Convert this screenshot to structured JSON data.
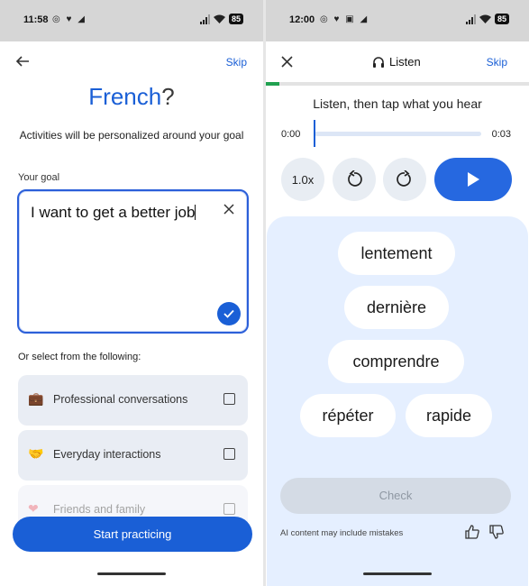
{
  "left": {
    "status": {
      "time": "11:58",
      "icons": "◎ ♥ ◢",
      "battery": "85"
    },
    "skip": "Skip",
    "title": {
      "lang": "French",
      "q": "?"
    },
    "subtitle": "Activities will be personalized around your goal",
    "goal": {
      "label": "Your goal",
      "text": "I want to get a better job"
    },
    "or_select": "Or select from the following:",
    "options": [
      {
        "icon": "briefcase-icon",
        "glyph": "💼",
        "label": "Professional conversations"
      },
      {
        "icon": "handshake-icon",
        "glyph": "🤝",
        "label": "Everyday interactions"
      },
      {
        "icon": "heart-icon",
        "glyph": "❤",
        "label": "Friends and family"
      }
    ],
    "start_button": "Start practicing"
  },
  "right": {
    "status": {
      "time": "12:00",
      "icons": "◎ ♥ ▣ ◢",
      "battery": "85"
    },
    "header": {
      "title": "Listen",
      "skip": "Skip"
    },
    "lesson_progress": 0.05,
    "instruction": "Listen, then tap what you hear",
    "audio": {
      "current": "0:00",
      "duration": "0:03",
      "position": 0.0,
      "speed": "1.0x"
    },
    "words": [
      "lentement",
      "dernière",
      "comprendre",
      "répéter",
      "rapide"
    ],
    "check_button": "Check",
    "ai_note": "AI content may include mistakes"
  },
  "colors": {
    "accent": "#1a5fd6",
    "progress_green": "#21a150",
    "word_area": "#e5efff"
  }
}
